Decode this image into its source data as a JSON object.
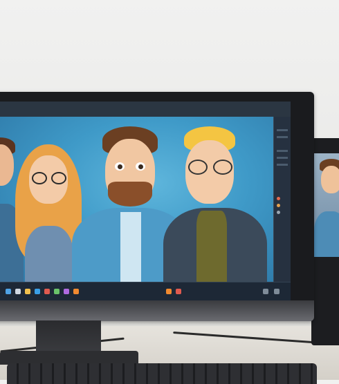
{
  "screen": {
    "topbar_labels": [
      "",
      ""
    ],
    "taskbar_icons": [
      {
        "name": "start-icon",
        "color": "#4fa3e6"
      },
      {
        "name": "search-icon",
        "color": "#cfd8e2"
      },
      {
        "name": "folder-icon",
        "color": "#f2c14e"
      },
      {
        "name": "browser-icon",
        "color": "#3aa0e8"
      },
      {
        "name": "mail-icon",
        "color": "#e05a4f"
      },
      {
        "name": "store-icon",
        "color": "#6ac36a"
      },
      {
        "name": "app-icon",
        "color": "#b06ae0"
      },
      {
        "name": "media-icon",
        "color": "#f08a30"
      }
    ]
  },
  "colors": {
    "canvas_blue": "#3f9ac8",
    "skin": "#f1c7a2",
    "hair_brown": "#6b3f22",
    "hair_blonde": "#f4c542",
    "hair_orange": "#e9a248",
    "shirt_blue": "#4d9bc8",
    "shirt_dark": "#3b4a5a",
    "shirt_olive": "#6e6a2e"
  }
}
